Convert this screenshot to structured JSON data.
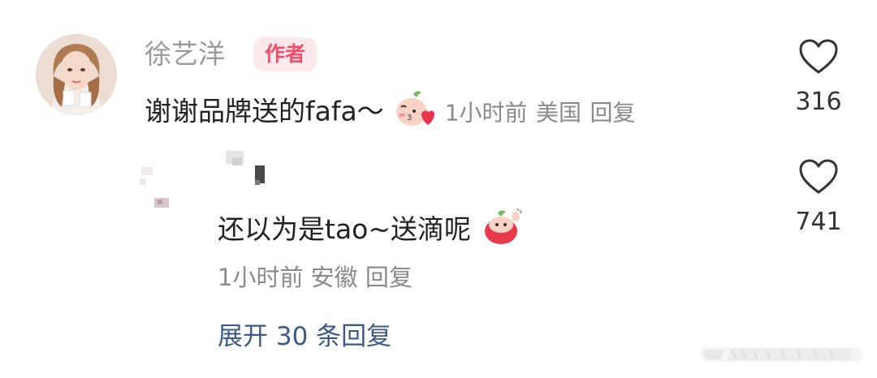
{
  "comment": {
    "username": "徐艺洋",
    "badge": "作者",
    "text": "谢谢品牌送的fafa～",
    "time": "1小时前",
    "location": "美国",
    "reply_label": "回复",
    "like_count": "316"
  },
  "reply": {
    "text": "还以为是tao~送滴呢",
    "time": "1小时前",
    "location": "安徽",
    "reply_label": "回复",
    "like_count": "741"
  },
  "expand_label": "展开 30 条回复",
  "colors": {
    "author_badge_bg": "#fde9ec",
    "author_badge_text": "#f0506e",
    "link": "#3b5a8a",
    "meta": "#8a8a8a"
  }
}
